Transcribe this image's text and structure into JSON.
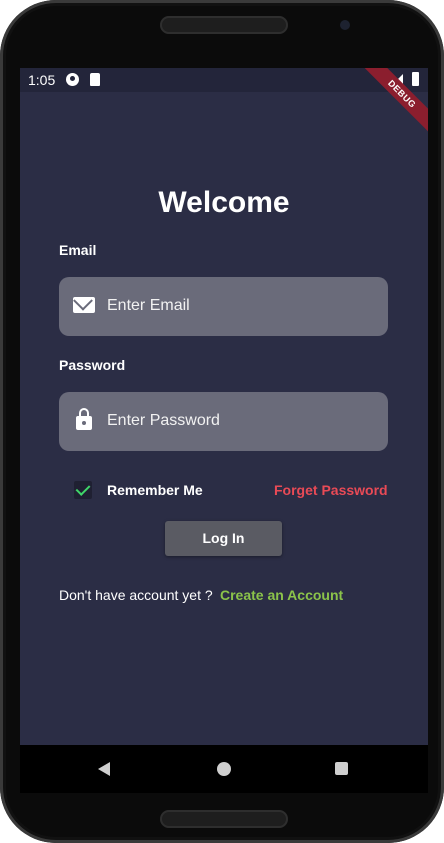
{
  "status_bar": {
    "time": "1:05"
  },
  "debug_banner": "DEBUG",
  "title": "Welcome",
  "email": {
    "label": "Email",
    "placeholder": "Enter Email",
    "icon": "mail-icon"
  },
  "password": {
    "label": "Password",
    "placeholder": "Enter Password",
    "icon": "lock-icon"
  },
  "remember_me": {
    "label": "Remember Me",
    "checked": true
  },
  "forget_password": "Forget Password",
  "login_button": "Log In",
  "signup": {
    "prompt": "Don't have account yet ?",
    "link": "Create an Account"
  },
  "colors": {
    "background": "#2b2d45",
    "field": "#6a6b7a",
    "accent_red": "#e94a56",
    "accent_green": "#8bc34a",
    "check_green": "#3fd66a"
  }
}
